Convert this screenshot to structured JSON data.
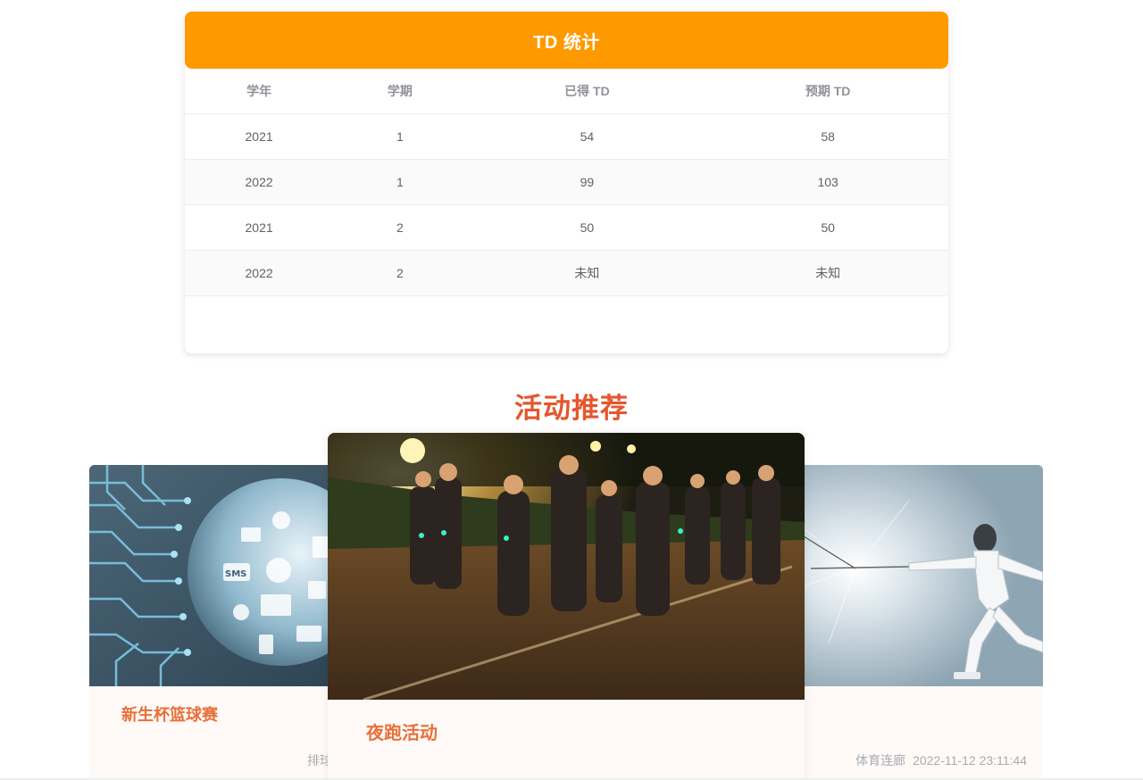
{
  "td_stats": {
    "title": "TD 统计",
    "columns": [
      "学年",
      "学期",
      "已得 TD",
      "预期 TD"
    ],
    "rows": [
      [
        "2021",
        "1",
        "54",
        "58"
      ],
      [
        "2022",
        "1",
        "99",
        "103"
      ],
      [
        "2021",
        "2",
        "50",
        "50"
      ],
      [
        "2022",
        "2",
        "未知",
        "未知"
      ]
    ]
  },
  "recommendations": {
    "title": "活动推荐",
    "cards": [
      {
        "name": "新生杯篮球赛",
        "location": "排球",
        "time": "",
        "image": "circuit-globe-image"
      },
      {
        "name": "夜跑活动",
        "location": "",
        "time": "",
        "image": "night-run-photo"
      },
      {
        "name": "",
        "location": "体育连廊",
        "time": "2022-11-12 23:11:44",
        "image": "fencing-photo"
      }
    ]
  },
  "colors": {
    "header_orange": "#ff9900",
    "accent_red": "#e4572e",
    "card_title": "#e8703a"
  }
}
